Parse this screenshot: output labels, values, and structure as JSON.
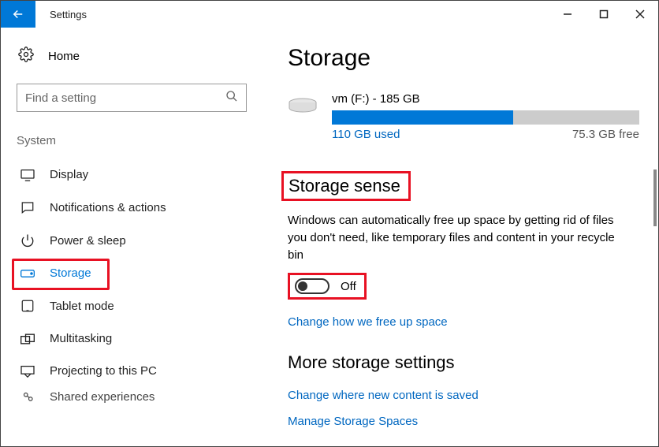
{
  "window": {
    "title": "Settings"
  },
  "sidebar": {
    "home": "Home",
    "search_placeholder": "Find a setting",
    "section": "System",
    "items": [
      {
        "label": "Display"
      },
      {
        "label": "Notifications & actions"
      },
      {
        "label": "Power & sleep"
      },
      {
        "label": "Storage"
      },
      {
        "label": "Tablet mode"
      },
      {
        "label": "Multitasking"
      },
      {
        "label": "Projecting to this PC"
      },
      {
        "label": "Shared experiences"
      }
    ]
  },
  "page": {
    "heading": "Storage",
    "drive": {
      "name": "vm (F:) - 185 GB",
      "used_label": "110 GB used",
      "free_label": "75.3 GB free",
      "used_percent": 59
    },
    "sense": {
      "title": "Storage sense",
      "desc": "Windows can automatically free up space by getting rid of files you don't need, like temporary files and content in your recycle bin",
      "state": "Off",
      "link": "Change how we free up space"
    },
    "more": {
      "title": "More storage settings",
      "link1": "Change where new content is saved",
      "link2": "Manage Storage Spaces"
    }
  }
}
